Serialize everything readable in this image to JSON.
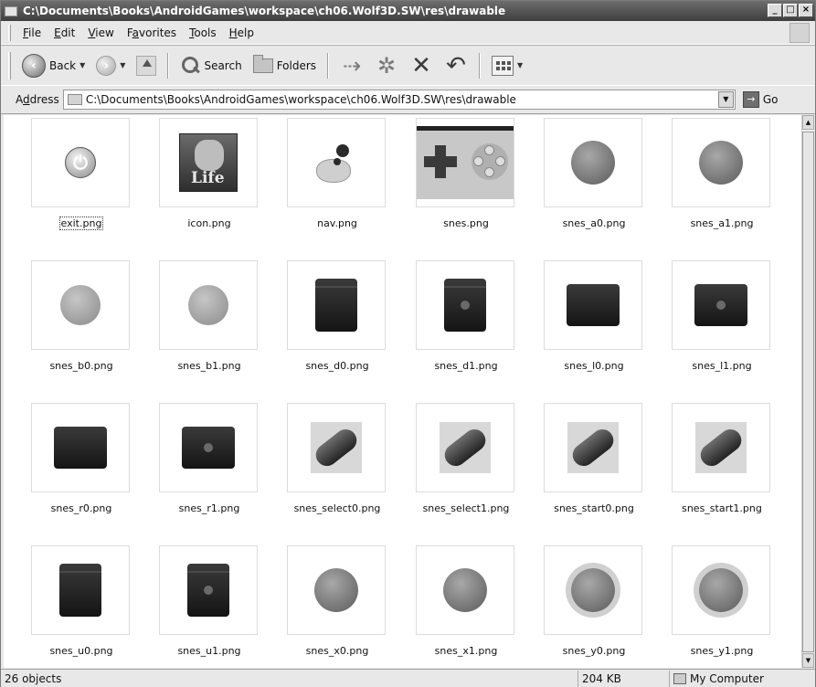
{
  "window": {
    "title": "C:\\Documents\\Books\\AndroidGames\\workspace\\ch06.Wolf3D.SW\\res\\drawable",
    "controls": [
      "_",
      "□",
      "×"
    ]
  },
  "menu": {
    "items": [
      {
        "key": "F",
        "rest": "ile"
      },
      {
        "key": "E",
        "rest": "dit"
      },
      {
        "key": "V",
        "rest": "iew"
      },
      {
        "pre": "F",
        "key": "a",
        "rest": "vorites"
      },
      {
        "key": "T",
        "rest": "ools"
      },
      {
        "key": "H",
        "rest": "elp"
      }
    ]
  },
  "toolbar": {
    "back_label": "Back",
    "search_label": "Search",
    "folders_label": "Folders"
  },
  "address": {
    "label_key": "d",
    "label_pre": "A",
    "label_rest": "dress",
    "value": "C:\\Documents\\Books\\AndroidGames\\workspace\\ch06.Wolf3D.SW\\res\\drawable",
    "go_label": "Go"
  },
  "files": [
    {
      "name": "exit.png",
      "thumb": "power"
    },
    {
      "name": "icon.png",
      "thumb": "face"
    },
    {
      "name": "nav.png",
      "thumb": "joystick"
    },
    {
      "name": "snes.png",
      "thumb": "controller"
    },
    {
      "name": "snes_a0.png",
      "thumb": "ball"
    },
    {
      "name": "snes_a1.png",
      "thumb": "ball"
    },
    {
      "name": "snes_b0.png",
      "thumb": "ball-light"
    },
    {
      "name": "snes_b1.png",
      "thumb": "ball-light"
    },
    {
      "name": "snes_d0.png",
      "thumb": "tall"
    },
    {
      "name": "snes_d1.png",
      "thumb": "tall-lit"
    },
    {
      "name": "snes_l0.png",
      "thumb": "wide"
    },
    {
      "name": "snes_l1.png",
      "thumb": "wide-lit"
    },
    {
      "name": "snes_r0.png",
      "thumb": "wide"
    },
    {
      "name": "snes_r1.png",
      "thumb": "wide-lit"
    },
    {
      "name": "snes_select0.png",
      "thumb": "pill"
    },
    {
      "name": "snes_select1.png",
      "thumb": "pill"
    },
    {
      "name": "snes_start0.png",
      "thumb": "pill"
    },
    {
      "name": "snes_start1.png",
      "thumb": "pill"
    },
    {
      "name": "snes_u0.png",
      "thumb": "tall"
    },
    {
      "name": "snes_u1.png",
      "thumb": "tall-lit"
    },
    {
      "name": "snes_x0.png",
      "thumb": "ball"
    },
    {
      "name": "snes_x1.png",
      "thumb": "ball"
    },
    {
      "name": "snes_y0.png",
      "thumb": "ball-sq"
    },
    {
      "name": "snes_y1.png",
      "thumb": "ball-sq"
    }
  ],
  "status": {
    "objects": "26 objects",
    "size": "204 KB",
    "zone": "My Computer"
  }
}
